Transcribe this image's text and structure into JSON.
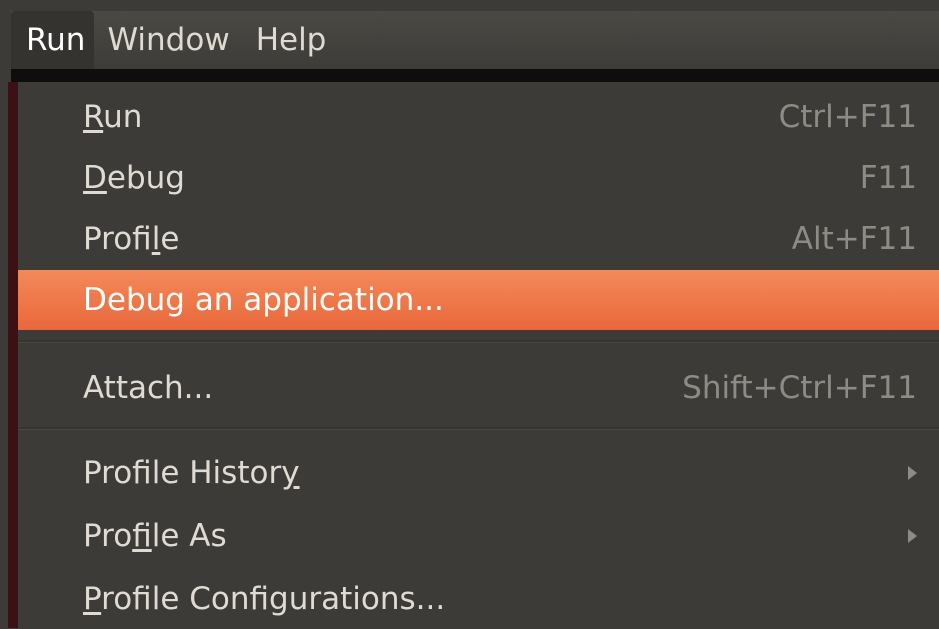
{
  "menubar": {
    "items": [
      "Run",
      "Window",
      "Help"
    ]
  },
  "dropdown": {
    "items": [
      {
        "label_pre": "",
        "mnemonic": "R",
        "label_post": "un",
        "shortcut": "Ctrl+F11"
      },
      {
        "label_pre": "",
        "mnemonic": "D",
        "label_post": "ebug",
        "shortcut": "F11"
      },
      {
        "label_pre": "Profi",
        "mnemonic": "l",
        "label_post": "e",
        "shortcut": "Alt+F11"
      },
      {
        "label_pre": "Debug an application...",
        "mnemonic": "",
        "label_post": "",
        "shortcut": ""
      },
      {
        "label_pre": "Attach...",
        "mnemonic": "",
        "label_post": "",
        "shortcut": "Shift+Ctrl+F11"
      },
      {
        "label_pre": "Profile Histor",
        "mnemonic": "y",
        "label_post": "",
        "shortcut": ""
      },
      {
        "label_pre": "Pro",
        "mnemonic": "f",
        "label_post": "ile As",
        "shortcut": ""
      },
      {
        "label_pre": "",
        "mnemonic": "P",
        "label_post": "rofile Configurations...",
        "shortcut": ""
      }
    ]
  },
  "colors": {
    "highlight": "#ef7a4a",
    "menu_bg": "#3c3b37",
    "text": "#dfdbd2",
    "shortcut_text": "#8d8b84"
  }
}
